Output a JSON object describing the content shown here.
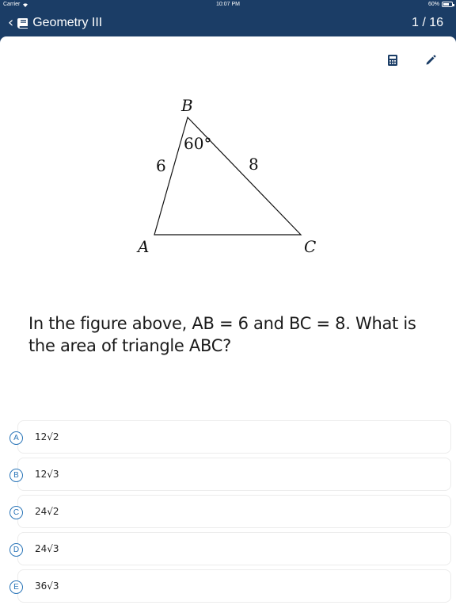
{
  "status_bar": {
    "carrier": "Carrier",
    "time": "10:07 PM",
    "battery": "60%"
  },
  "nav": {
    "back_icon": "chevron-left-icon",
    "title": "Geometry III",
    "progress": "1 / 16"
  },
  "tools": {
    "calculator_icon": "calculator-icon",
    "pencil_icon": "pencil-icon"
  },
  "figure": {
    "vertex_a": "A",
    "vertex_b": "B",
    "vertex_c": "C",
    "side_ab": "6",
    "side_bc": "8",
    "angle_b": "60°"
  },
  "question": {
    "text": "In the figure above, AB = 6 and BC = 8. What is the area of triangle ABC?"
  },
  "choices": [
    {
      "letter": "A",
      "text": "12√2"
    },
    {
      "letter": "B",
      "text": "12√3"
    },
    {
      "letter": "C",
      "text": "24√2"
    },
    {
      "letter": "D",
      "text": "24√3"
    },
    {
      "letter": "E",
      "text": "36√3"
    }
  ],
  "colors": {
    "header_bg": "#1b3d66",
    "accent": "#2a75b8"
  }
}
